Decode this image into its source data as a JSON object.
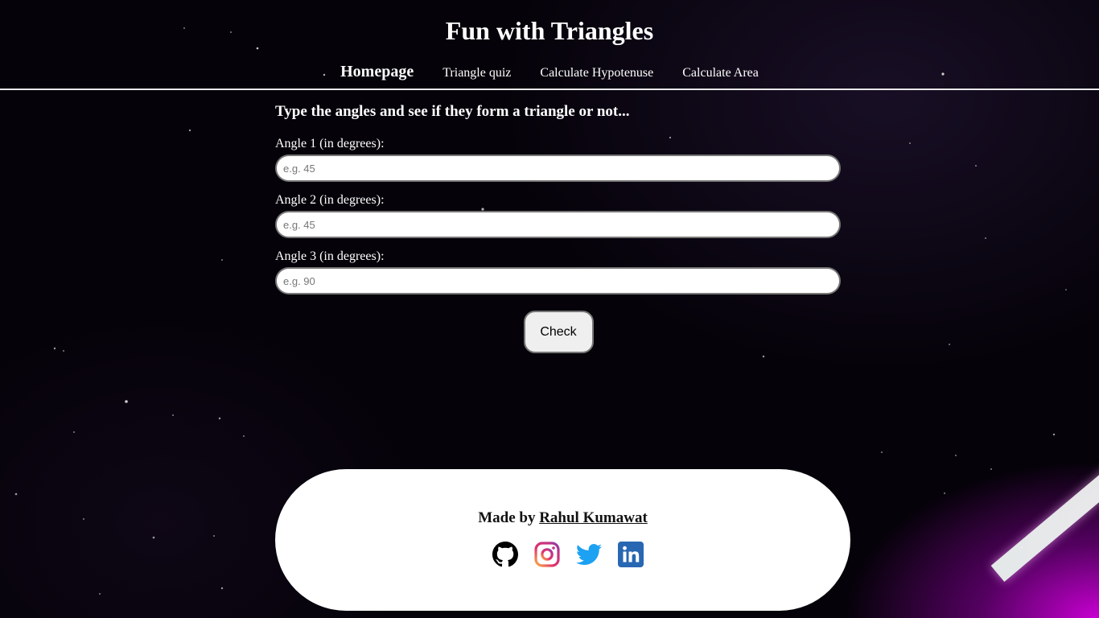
{
  "page": {
    "title": "Fun with Triangles"
  },
  "nav": {
    "items": [
      {
        "label": "Homepage",
        "active": true
      },
      {
        "label": "Triangle quiz",
        "active": false
      },
      {
        "label": "Calculate Hypotenuse",
        "active": false
      },
      {
        "label": "Calculate Area",
        "active": false
      }
    ]
  },
  "main": {
    "heading": "Type the angles and see if they form a triangle or not...",
    "fields": [
      {
        "label": "Angle 1 (in degrees):",
        "placeholder": "e.g. 45",
        "value": ""
      },
      {
        "label": "Angle 2 (in degrees):",
        "placeholder": "e.g. 45",
        "value": ""
      },
      {
        "label": "Angle 3 (in degrees):",
        "placeholder": "e.g. 90",
        "value": ""
      }
    ],
    "check_label": "Check"
  },
  "footer": {
    "made_by_prefix": "Made by",
    "author": "Rahul Kumawat",
    "socials": [
      {
        "icon": "github-icon",
        "color": "#000000"
      },
      {
        "icon": "instagram-icon",
        "color": "#c13584"
      },
      {
        "icon": "twitter-icon",
        "color": "#1da1f2"
      },
      {
        "icon": "linkedin-icon",
        "color": "#2867b2"
      }
    ]
  },
  "colors": {
    "background": "#050209",
    "accent_glow": "#d200dc",
    "text": "#ffffff",
    "footer_bg": "#ffffff"
  }
}
